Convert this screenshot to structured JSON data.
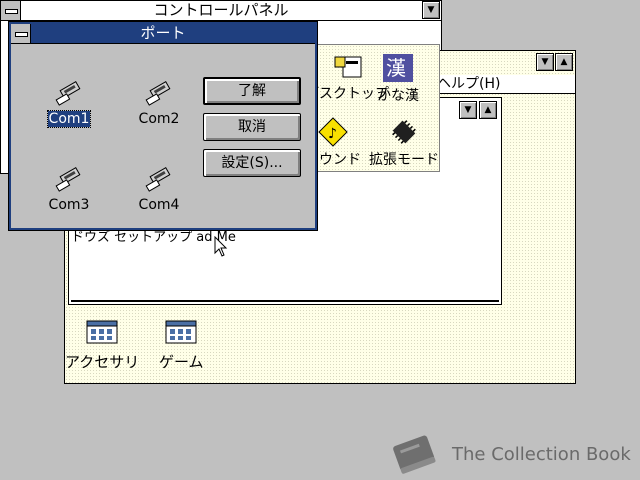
{
  "control_panel": {
    "title": "コントロールパネル",
    "items": [
      {
        "label": "デスクトップ",
        "icon": "desktop-icon"
      },
      {
        "label": "かな漢",
        "icon": "kana-kanji-icon"
      },
      {
        "label": "サウンド",
        "icon": "sound-icon"
      },
      {
        "label": "拡張モード",
        "icon": "enhanced-mode-chip-icon"
      }
    ]
  },
  "program_manager": {
    "menu_help": "ヘルプ(H)",
    "group_text": "ドウズ セットアップ ad Me",
    "groups": [
      {
        "label": "アクセサリ"
      },
      {
        "label": "ゲーム"
      }
    ]
  },
  "port_dialog": {
    "title": "ポート",
    "ports": [
      {
        "label": "Com1",
        "selected": true
      },
      {
        "label": "Com2",
        "selected": false
      },
      {
        "label": "Com3",
        "selected": false
      },
      {
        "label": "Com4",
        "selected": false
      }
    ],
    "buttons": {
      "ok": "了解",
      "cancel": "取消",
      "settings": "設定(S)..."
    }
  },
  "watermark": {
    "text": "The Collection Book"
  }
}
